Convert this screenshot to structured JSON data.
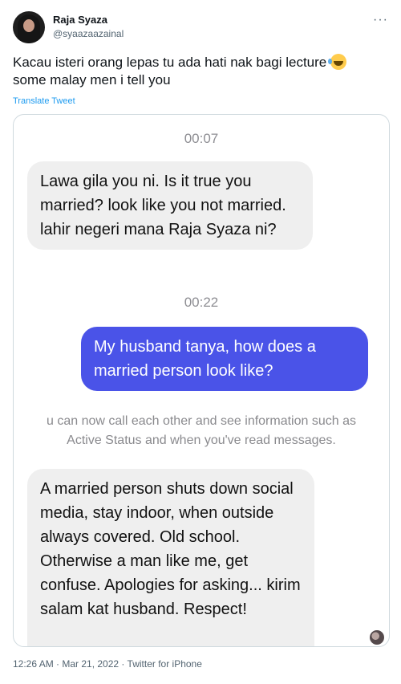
{
  "tweet": {
    "author_name": "Raja Syaza",
    "author_handle": "@syaazaazainal",
    "more_icon": "···",
    "text_line1": "Kacau isteri orang lepas tu ada hati nak bagi lecture",
    "emoji": "rolling-on-floor-laughing-emoji",
    "text_line2": "some malay men i tell you",
    "translate_label": "Translate Tweet",
    "footer_meta": "12:26 AM · Mar 21, 2022 · Twitter for iPhone"
  },
  "screenshot": {
    "timestamp_1": "00:07",
    "message_1": "Lawa gila you ni. Is it true you married? look like you not married. lahir negeri mana Raja Syaza ni?",
    "timestamp_2": "00:22",
    "message_2": "My husband tanya, how does a married person look like?",
    "notice_line1": "u can now call each other and see information such as",
    "notice_line2": "Active Status and when you've read messages.",
    "message_3": "A married person shuts down social media, stay indoor, when outside always covered. Old school. Otherwise a man like me, get confuse. Apologies for asking... kirim salam kat husband. Respect!"
  },
  "colors": {
    "outgoing_bubble": "#4a53e8",
    "incoming_bubble": "#efefef",
    "link": "#1d9bf0"
  }
}
